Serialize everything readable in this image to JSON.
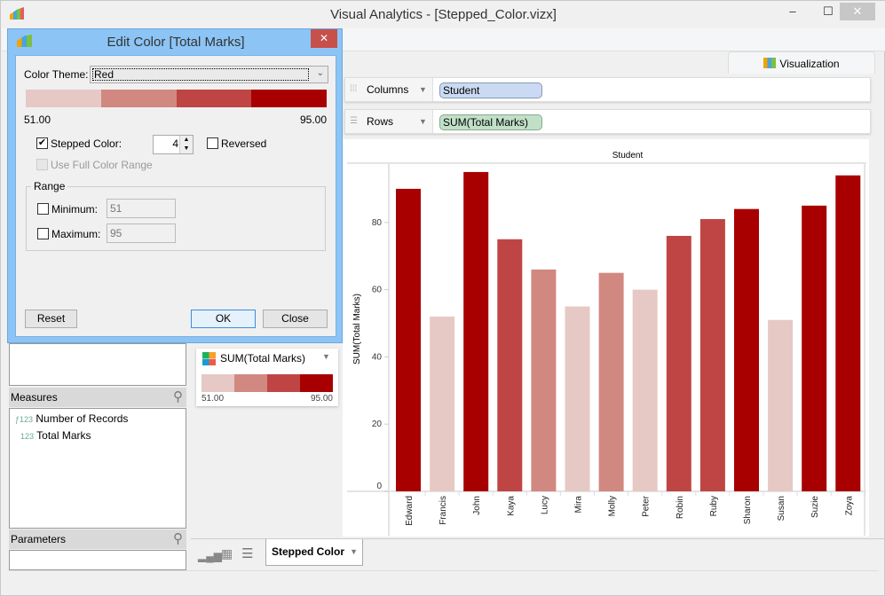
{
  "window": {
    "title": "Visual Analytics - [Stepped_Color.vizx]",
    "minimize": "‒",
    "maximize": "☐",
    "close": "✕"
  },
  "tab": {
    "label": "Visualization"
  },
  "shelves": {
    "columns_label": "Columns",
    "columns_pill": "Student",
    "rows_label": "Rows",
    "rows_pill": "SUM(Total Marks)"
  },
  "colors": {
    "steps": [
      "#e6c9c4",
      "#d18880",
      "#bf4545",
      "#a80000"
    ],
    "columns_pill": "#c9daf2",
    "rows_pill": "#c0e0c8"
  },
  "chart_data": {
    "type": "bar",
    "title": "Student",
    "xlabel": "",
    "ylabel": "SUM(Total Marks)",
    "ylim": [
      0,
      97
    ],
    "yticks": [
      0,
      20,
      40,
      60,
      80
    ],
    "categories": [
      "Edward",
      "Francis",
      "John",
      "Kaya",
      "Lucy",
      "Mira",
      "Molly",
      "Peter",
      "Robin",
      "Ruby",
      "Sharon",
      "Susan",
      "Suzie",
      "Zoya"
    ],
    "values": [
      90,
      52,
      95,
      75,
      66,
      55,
      65,
      60,
      76,
      81,
      84,
      51,
      85,
      94
    ],
    "color_range": [
      51,
      95
    ],
    "color_steps": 4
  },
  "left_pane": {
    "measures_header": "Measures",
    "measures": [
      {
        "icon": "ƒ123",
        "label": "Number of Records"
      },
      {
        "icon": "123",
        "label": "Total Marks"
      }
    ],
    "parameters_header": "Parameters"
  },
  "legend": {
    "title": "SUM(Total Marks)",
    "min": "51.00",
    "max": "95.00"
  },
  "sheet_tab": {
    "label": "Stepped Color"
  },
  "dialog": {
    "title": "Edit Color [Total Marks]",
    "close": "✕",
    "theme_label": "Color Theme:",
    "theme_value": "Red",
    "min_label": "51.00",
    "max_label": "95.00",
    "stepped_label": "Stepped Color:",
    "stepped_checked": "✔",
    "steps_value": "4",
    "reversed_label": "Reversed",
    "full_range_label": "Use Full Color Range",
    "range_label": "Range",
    "minimum_label": "Minimum:",
    "minimum_value": "51",
    "maximum_label": "Maximum:",
    "maximum_value": "95",
    "reset": "Reset",
    "ok": "OK",
    "close_btn": "Close"
  }
}
